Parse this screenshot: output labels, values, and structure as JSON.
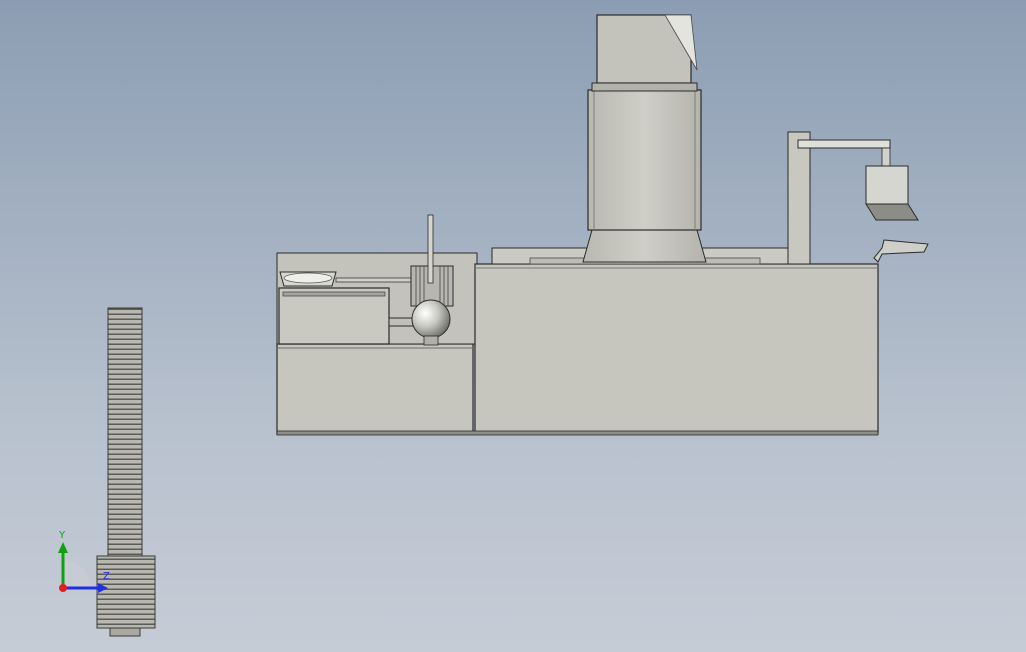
{
  "viewport": {
    "background_top": "#8c9db3",
    "background_bottom": "#c6ccd6",
    "model_fill": "#c6c6bf",
    "model_dark": "#9a9a93",
    "model_edge": "#2a2a2a"
  },
  "triad": {
    "y_label": "Y",
    "z_label": "Z",
    "y_color": "#10a010",
    "z_color": "#2030e0",
    "x_color": "#e02020"
  },
  "icons": [
    "coordinate-triad-icon"
  ]
}
